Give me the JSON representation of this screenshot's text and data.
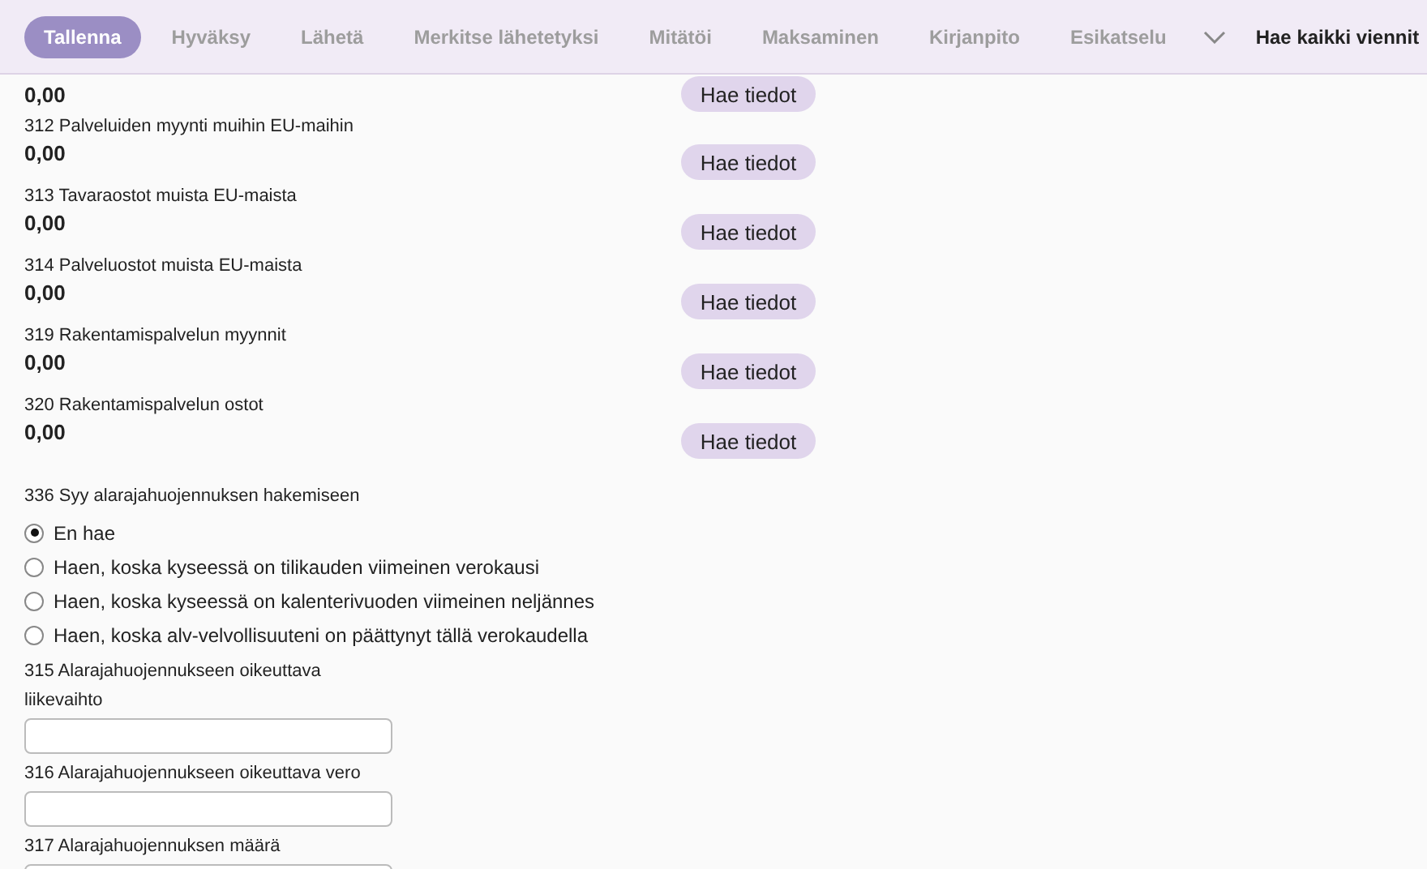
{
  "toolbar": {
    "tabs": [
      {
        "label": "Tallenna",
        "selected": true
      },
      {
        "label": "Hyväksy",
        "selected": false
      },
      {
        "label": "Lähetä",
        "selected": false
      },
      {
        "label": "Merkitse lähetetyksi",
        "selected": false
      },
      {
        "label": "Mitätöi",
        "selected": false
      },
      {
        "label": "Maksaminen",
        "selected": false
      },
      {
        "label": "Kirjanpito",
        "selected": false
      },
      {
        "label": "Esikatselu",
        "selected": false
      }
    ],
    "action": "Hae kaikki viennit"
  },
  "rows": [
    {
      "value": "0,00",
      "button": "Hae tiedot"
    },
    {
      "label": "312 Palveluiden myynti muihin EU-maihin",
      "value": "0,00",
      "button": "Hae tiedot"
    },
    {
      "label": "313 Tavaraostot muista EU-maista",
      "value": "0,00",
      "button": "Hae tiedot"
    },
    {
      "label": "314 Palveluostot muista EU-maista",
      "value": "0,00",
      "button": "Hae tiedot"
    },
    {
      "label": "319 Rakentamispalvelun myynnit",
      "value": "0,00",
      "button": "Hae tiedot"
    },
    {
      "label": "320 Rakentamispalvelun ostot",
      "value": "0,00",
      "button": "Hae tiedot"
    }
  ],
  "reason": {
    "label": "336 Syy alarajahuojennuksen hakemiseen",
    "options": [
      {
        "label": "En hae",
        "selected": true
      },
      {
        "label": "Haen, koska kyseessä on tilikauden viimeinen verokausi",
        "selected": false
      },
      {
        "label": "Haen, koska kyseessä on kalenterivuoden viimeinen neljännes",
        "selected": false
      },
      {
        "label": "Haen, koska alv-velvollisuuteni on päättynyt tällä verokaudella",
        "selected": false
      }
    ]
  },
  "fields": [
    {
      "label": "315 Alarajahuojennukseen oikeuttava liikevaihto"
    },
    {
      "label": "316 Alarajahuojennukseen oikeuttava vero"
    },
    {
      "label": "317 Alarajahuojennuksen määrä"
    }
  ]
}
